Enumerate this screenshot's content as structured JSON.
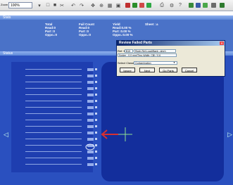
{
  "toolbar": {
    "zoom_label": "Zoom",
    "zoom_value": "100%",
    "icons": [
      "arrow-icon",
      "save-icon",
      "cut-icon",
      "zoom-icon",
      "grid-icon",
      "color-icon",
      "select-icon",
      "view-icon",
      "tool-icon",
      "settings-icon"
    ]
  },
  "stats_panel": {
    "title": "Stats",
    "total_label": "Total",
    "total_lines": [
      "Read:0",
      "Part :0",
      "Oppo.:0"
    ],
    "fail_label": "Fail Count",
    "fail_lines": [
      "Read:0",
      "Part :0",
      "Oppo.:0"
    ],
    "yield_label": "Yield",
    "yield_lines": [
      "Read:0.00 %",
      "Part :0.00 %",
      "Oppo.:0.00 %"
    ],
    "sheet_label": "Sheet :",
    "sheet_value": "a"
  },
  "view_panel": {
    "title": "Status"
  },
  "dialog": {
    "title": "Review Failed Parts",
    "ref_label": "Ref. ID",
    "ref_value": "B19",
    "ref_desc": "Rgnh-Ref-Load(Bank .vimn)",
    "comment": "Solder - 0.0 mm(Thru-Width: CB) / 0.6",
    "classification_label": "Select Classification",
    "classification_value": "Contamination",
    "buttons": [
      "Ignore",
      "Next",
      "Go Parts",
      "Cancel"
    ]
  },
  "accent": "#2a50bf"
}
